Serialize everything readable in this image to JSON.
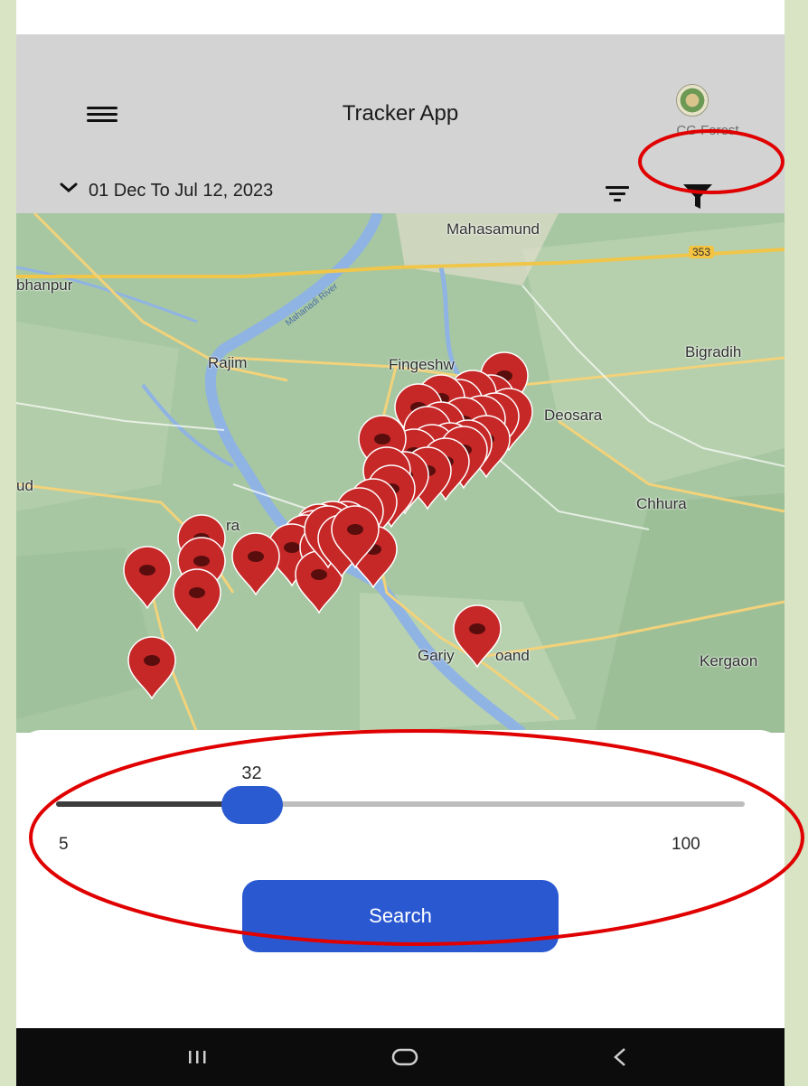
{
  "header": {
    "title": "Tracker App",
    "logo_label": "CG Forest",
    "date_range": "01 Dec To Jul 12, 2023",
    "icons": [
      "menu-icon",
      "chevron-down-icon",
      "sort-icon",
      "filter-icon",
      "emblem-logo"
    ]
  },
  "map": {
    "places": {
      "mahasamund": "Mahasamund",
      "route_353": "353",
      "bhanpur": "bhanpur",
      "rajim": "Rajim",
      "fingeshwar": "Fingeshw",
      "bigradih": "Bigradih",
      "deosara": "Deosara",
      "ud": "ud",
      "chhura": "Chhura",
      "ra": "ra",
      "gariyaband_a": "Gariy",
      "gariyaband_b": "oand",
      "kergaon": "Kergaon",
      "river": "Mahanadi River"
    },
    "marker_icon": "location-pin-icon",
    "marker_color": "#c62828"
  },
  "slider": {
    "value": "32",
    "min": "5",
    "max": "100",
    "value_fraction": 0.2842,
    "accent": "#2b5bd0"
  },
  "search": {
    "label": "Search"
  },
  "navbar": {
    "icons": [
      "recent-apps-icon",
      "home-icon",
      "back-icon"
    ]
  },
  "annotation_color": "#e00000"
}
